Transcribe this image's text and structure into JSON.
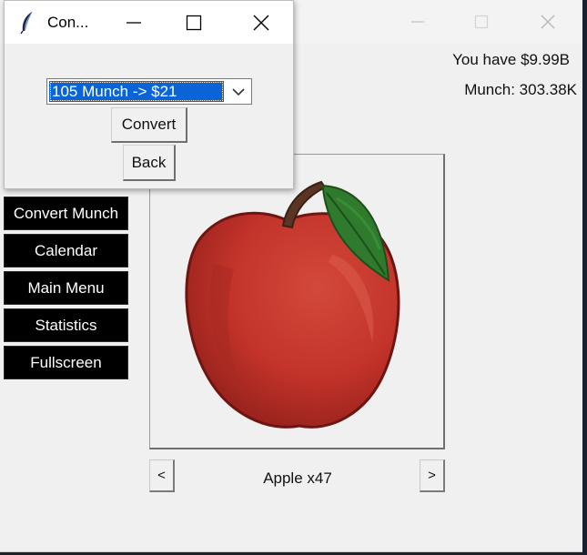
{
  "main_window": {
    "money": "You have $9.99B",
    "munch": "Munch: 303.38K",
    "side_buttons": [
      "Convert Munch",
      "Calendar",
      "Main Menu",
      "Statistics",
      "Fullscreen"
    ],
    "prev_label": "<",
    "next_label": ">",
    "item_label": "Apple x47",
    "item_icon": "apple-icon"
  },
  "convert_window": {
    "title": "Con...",
    "rate_selected": "105 Munch -> $21",
    "convert_label": "Convert",
    "back_label": "Back"
  },
  "colors": {
    "selection": "#0a64d8",
    "side_button_bg": "#000000",
    "apple_red": "#c8342a",
    "leaf_green": "#2f7a2c"
  }
}
